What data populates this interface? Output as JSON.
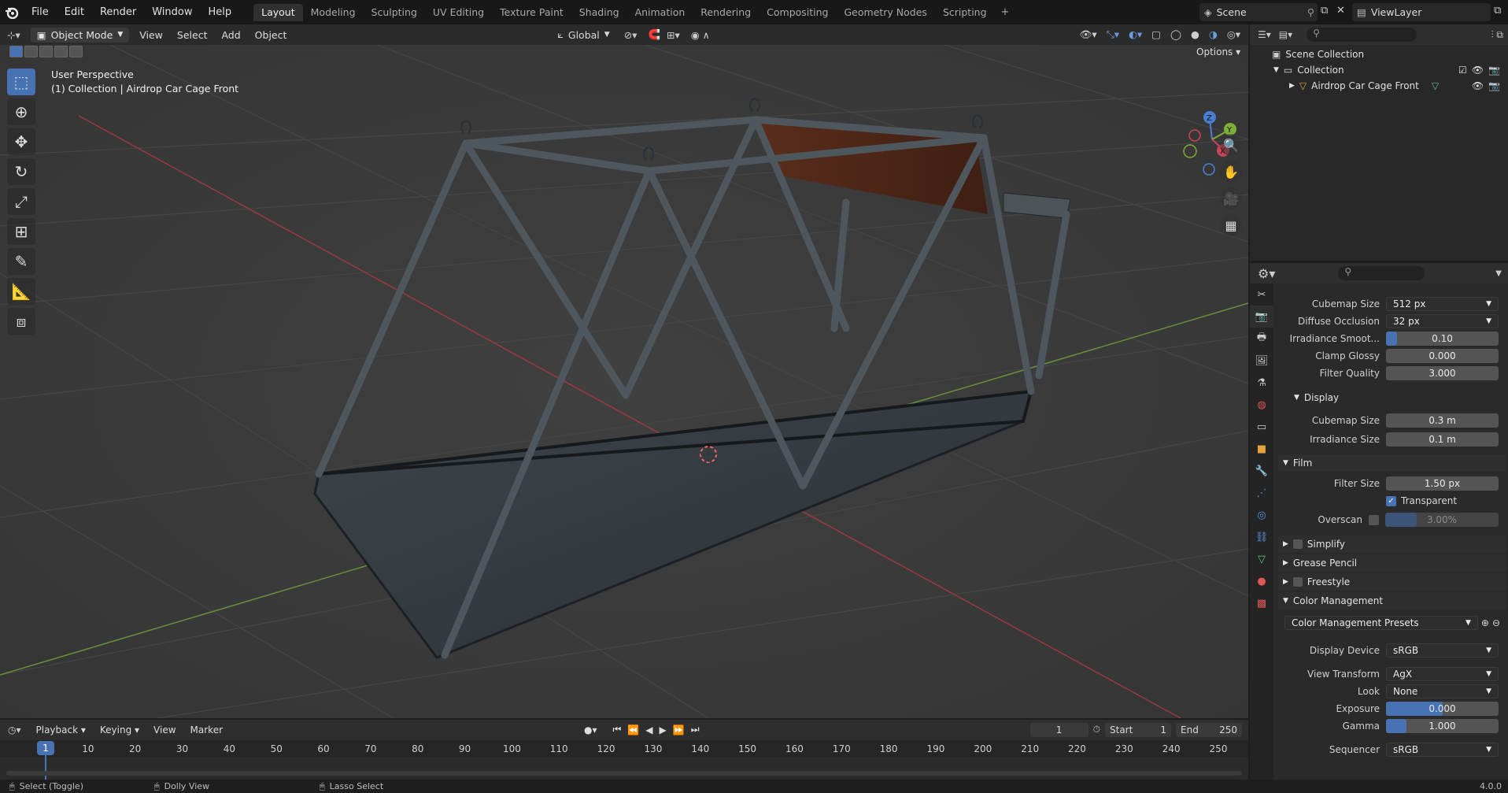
{
  "topbar": {
    "menus": [
      "File",
      "Edit",
      "Render",
      "Window",
      "Help"
    ],
    "workspaces": [
      "Layout",
      "Modeling",
      "Sculpting",
      "UV Editing",
      "Texture Paint",
      "Shading",
      "Animation",
      "Rendering",
      "Compositing",
      "Geometry Nodes",
      "Scripting"
    ],
    "active_workspace": "Layout",
    "scene_name": "Scene",
    "view_layer": "ViewLayer"
  },
  "viewport_header": {
    "mode": "Object Mode",
    "menus": [
      "View",
      "Select",
      "Add",
      "Object"
    ],
    "transform_orientation": "Global",
    "options_label": "Options"
  },
  "viewport": {
    "perspective_label": "User Perspective",
    "collection_label": "(1) Collection | Airdrop Car Cage Front",
    "gizmo": {
      "z": "Z",
      "y": "Y",
      "x": "X"
    }
  },
  "outliner": {
    "rows": [
      {
        "label": "Scene Collection"
      },
      {
        "label": "Collection"
      },
      {
        "label": "Airdrop Car Cage Front"
      }
    ]
  },
  "properties": {
    "rows": {
      "cubemap_size": {
        "label": "Cubemap Size",
        "value": "512 px"
      },
      "diffuse_occlusion": {
        "label": "Diffuse Occlusion",
        "value": "32 px"
      },
      "irradiance_smooth": {
        "label": "Irradiance Smoot...",
        "value": "0.10",
        "fill": 0.1
      },
      "clamp_glossy": {
        "label": "Clamp Glossy",
        "value": "0.000"
      },
      "filter_quality": {
        "label": "Filter Quality",
        "value": "3.000"
      },
      "display_section": "Display",
      "display_cubemap": {
        "label": "Cubemap Size",
        "value": "0.3 m"
      },
      "display_irradiance": {
        "label": "Irradiance Size",
        "value": "0.1 m"
      },
      "film_section": "Film",
      "filter_size": {
        "label": "Filter Size",
        "value": "1.50 px"
      },
      "transparent": {
        "label": "Transparent",
        "checked": true
      },
      "overscan": {
        "label": "Overscan",
        "value": "3.00%"
      },
      "simplify": "Simplify",
      "grease_pencil": "Grease Pencil",
      "freestyle": "Freestyle",
      "color_management": "Color Management",
      "cm_presets": "Color Management Presets",
      "display_device": {
        "label": "Display Device",
        "value": "sRGB"
      },
      "view_transform": {
        "label": "View Transform",
        "value": "AgX"
      },
      "look": {
        "label": "Look",
        "value": "None"
      },
      "exposure": {
        "label": "Exposure",
        "value": "0.000",
        "fill": 0.5
      },
      "gamma": {
        "label": "Gamma",
        "value": "1.000",
        "fill": 0.18
      },
      "sequencer": {
        "label": "Sequencer",
        "value": "sRGB"
      }
    }
  },
  "timeline": {
    "menus": [
      "Playback",
      "Keying",
      "View",
      "Marker"
    ],
    "current_frame": "1",
    "start_label": "Start",
    "start": "1",
    "end_label": "End",
    "end": "250",
    "ticks": [
      "10",
      "20",
      "30",
      "40",
      "50",
      "60",
      "70",
      "80",
      "90",
      "100",
      "110",
      "120",
      "130",
      "140",
      "150",
      "160",
      "170",
      "180",
      "190",
      "200",
      "210",
      "220",
      "230",
      "240",
      "250"
    ],
    "playhead": "1"
  },
  "statusbar": {
    "select": "Select (Toggle)",
    "dolly": "Dolly View",
    "lasso": "Lasso Select",
    "version": "4.0.0"
  },
  "colors": {
    "accent": "#4772b3",
    "x_axis": "#c8445a",
    "y_axis": "#7fae3a",
    "z_axis": "#4a7fd0"
  }
}
